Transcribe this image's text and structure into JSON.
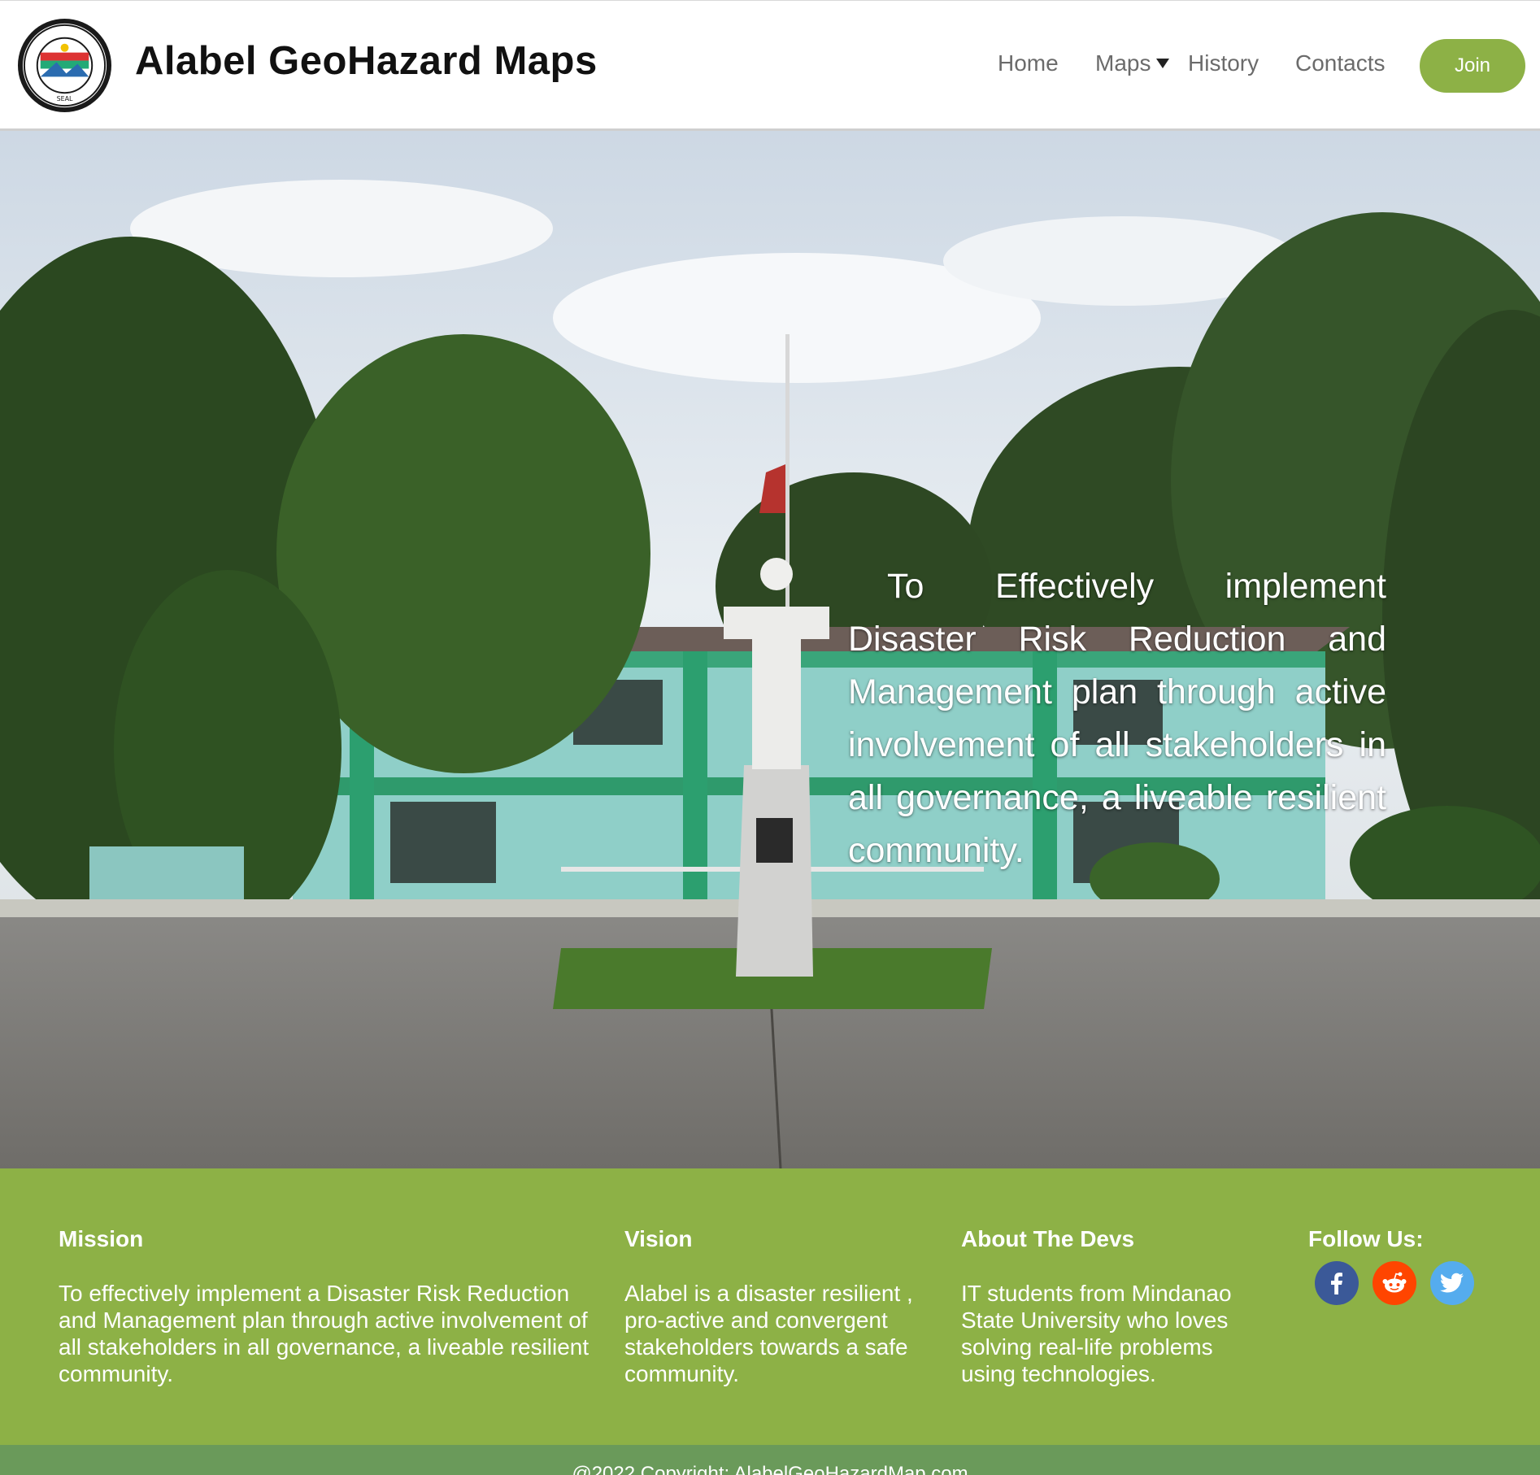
{
  "header": {
    "title": "Alabel GeoHazard Maps",
    "nav": {
      "home": "Home",
      "maps": "Maps",
      "history": "History",
      "contacts": "Contacts"
    },
    "join_label": "Join"
  },
  "hero": {
    "text": "To Effectively implement Disaster Risk Reduction and Management plan through active involvement of all stakeholders in all governance, a liveable resilient community."
  },
  "footer": {
    "mission": {
      "heading": "Mission",
      "body": "To effectively implement a Disaster Risk Reduction and Management plan through active involvement of all stakeholders in all governance, a liveable resilient community."
    },
    "vision": {
      "heading": "Vision",
      "body": "Alabel is a disaster resilient , pro-active and convergent stakeholders towards a safe community."
    },
    "devs": {
      "heading": "About The Devs",
      "body": "IT students from Mindanao State University who loves solving real-life problems using technologies."
    },
    "follow": {
      "heading": "Follow Us:",
      "icons": [
        "facebook-icon",
        "reddit-icon",
        "twitter-icon"
      ]
    },
    "copyright": "@2022 Copyright: AlabelGeoHazardMap.com"
  },
  "colors": {
    "brand_green": "#8db146",
    "copyright_green": "#6a9a5a",
    "facebook": "#3b5998",
    "reddit": "#ff4500",
    "twitter": "#55acee"
  }
}
